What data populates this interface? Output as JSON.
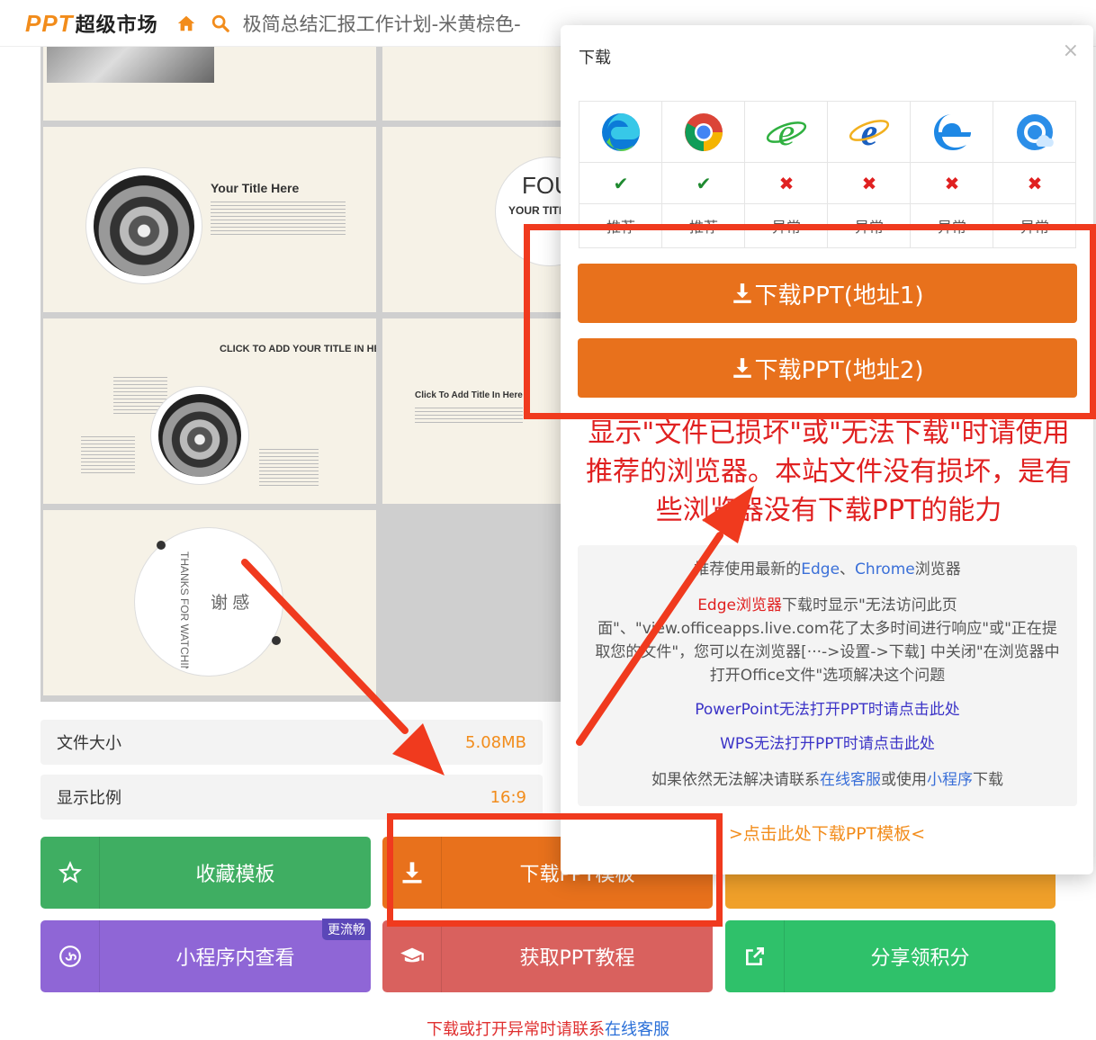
{
  "header": {
    "logo_ppt": "PPT",
    "logo_rest": "超级市场",
    "title": "极简总结汇报工作计划-米黄棕色-"
  },
  "slides": {
    "title_here": "Your Title Here",
    "click_add": "CLICK TO ADD YOUR TITLE IN HERE",
    "click_add_small": "Click To Add Title In Here",
    "fou": "FOU",
    "your_title": "YOUR TITLE",
    "thanks": "谢 感",
    "thanks_en": "THANKS FOR WATCHING"
  },
  "info": {
    "size_label": "文件大小",
    "size_value": "5.08MB",
    "ratio_label": "显示比例",
    "ratio_value": "16:9"
  },
  "buttons": {
    "collect": "收藏模板",
    "download": "下载PPT模板",
    "miniapp": "小程序内查看",
    "miniapp_badge": "更流畅",
    "tutorial": "获取PPT教程",
    "share": "分享领积分"
  },
  "footer": {
    "text": "下载或打开异常时请联系",
    "link": "在线客服"
  },
  "modal": {
    "title": "下载",
    "close": "×",
    "browsers": [
      {
        "icon": "edge-chromium-icon",
        "ok": true,
        "mark": "✔",
        "status": "推荐"
      },
      {
        "icon": "chrome-icon",
        "ok": true,
        "mark": "✔",
        "status": "推荐"
      },
      {
        "icon": "ie-green-icon",
        "ok": false,
        "mark": "✖",
        "status": "异常"
      },
      {
        "icon": "ie-icon",
        "ok": false,
        "mark": "✖",
        "status": "异常"
      },
      {
        "icon": "edge-legacy-icon",
        "ok": false,
        "mark": "✖",
        "status": "异常"
      },
      {
        "icon": "cloud-browser-icon",
        "ok": false,
        "mark": "✖",
        "status": "异常"
      }
    ],
    "download1": "下载PPT(地址1)",
    "download2": "下载PPT(地址2)",
    "warning": "显示\"文件已损坏\"或\"无法下载\"时请使用推荐的浏览器。本站文件没有损坏，是有些浏览器没有下载PPT的能力",
    "help": {
      "l1_pre": "推荐使用最新的",
      "l1_edge": "Edge",
      "l1_sep": "、",
      "l1_chrome": "Chrome",
      "l1_post": "浏览器",
      "l2_red": "Edge浏览器",
      "l2_rest": "下载时显示\"无法访问此页面\"、\"view.officeapps.live.com花了太多时间进行响应\"或\"正在提取您的文件\"，您可以在浏览器[···->设置->下载] 中关闭\"在浏览器中打开Office文件\"选项解决这个问题",
      "ppt_link": "PowerPoint无法打开PPT时请点击此处",
      "wps_link": "WPS无法打开PPT时请点击此处",
      "contact_pre": "如果依然无法解决请联系",
      "contact_service": "在线客服",
      "contact_mid": "或使用",
      "contact_mini": "小程序",
      "contact_post": "下载"
    },
    "template_link": ">点击此处下载PPT模板<"
  },
  "colors": {
    "brand_orange": "#f28c1b",
    "download_orange": "#e8711c",
    "annotation_red": "#f03a1e",
    "green": "#3fae62",
    "purple": "#8f66d6",
    "salmon": "#d9615e",
    "share_green": "#2fc16a"
  }
}
